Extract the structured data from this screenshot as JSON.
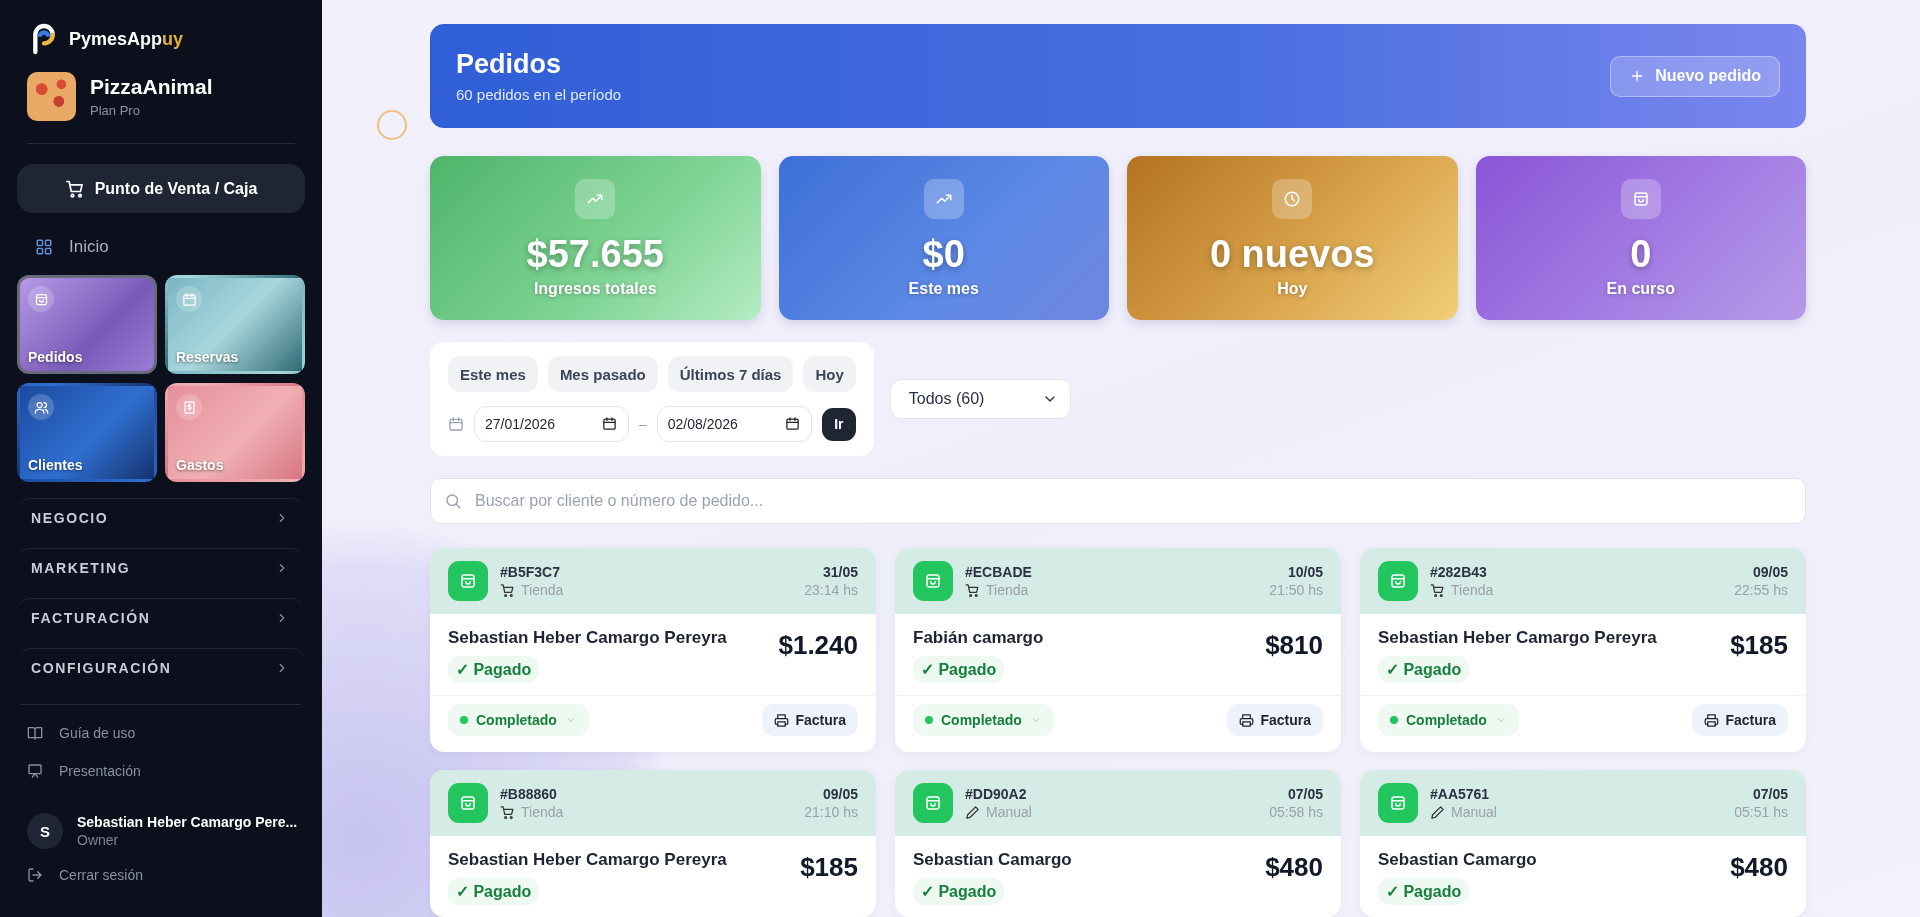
{
  "sidebar": {
    "brand": {
      "prefix": "PymesApp",
      "suffix": "uy"
    },
    "business": {
      "name": "PizzaAnimal",
      "plan": "Plan Pro"
    },
    "pos_button": "Punto de Venta / Caja",
    "home": "Inicio",
    "tiles": [
      {
        "label": "Pedidos",
        "kind": "pedidos",
        "selected": true
      },
      {
        "label": "Reservas",
        "kind": "reservas",
        "selected": false
      },
      {
        "label": "Clientes",
        "kind": "clientes",
        "selected": false
      },
      {
        "label": "Gastos",
        "kind": "gastos",
        "selected": false
      }
    ],
    "sections": [
      {
        "label": "NEGOCIO",
        "expanded": false
      },
      {
        "label": "MARKETING",
        "expanded": false
      },
      {
        "label": "FACTURACIÓN",
        "expanded": false
      },
      {
        "label": "CONFIGURACIÓN",
        "expanded": false
      }
    ],
    "links": [
      {
        "label": "Guía de uso",
        "kind": "guide"
      },
      {
        "label": "Presentación",
        "kind": "presentation"
      }
    ],
    "user": {
      "initial": "S",
      "name": "Sebastian Heber Camargo Pere...",
      "role": "Owner"
    },
    "logout": "Cerrar sesión"
  },
  "header": {
    "title": "Pedidos",
    "subtitle": "60 pedidos en el período",
    "button": "Nuevo pedido"
  },
  "stats": [
    {
      "value": "$57.655",
      "label": "Ingresos totales",
      "kind": "revenue"
    },
    {
      "value": "$0",
      "label": "Este mes",
      "kind": "month"
    },
    {
      "value": "0 nuevos",
      "label": "Hoy",
      "kind": "today"
    },
    {
      "value": "0",
      "label": "En curso",
      "kind": "progress"
    }
  ],
  "filters": {
    "presets": [
      {
        "label": "Este mes",
        "selected": false
      },
      {
        "label": "Mes pasado",
        "selected": false
      },
      {
        "label": "Últimos 7 días",
        "selected": false
      },
      {
        "label": "Hoy",
        "selected": false
      }
    ],
    "date_from": "27/01/2026",
    "separator": "–",
    "date_to": "02/08/2026",
    "go_button": "Ir",
    "status_select": "Todos (60)"
  },
  "search": {
    "placeholder": "Buscar por cliente o número de pedido..."
  },
  "orders": [
    {
      "id": "#B5F3C7",
      "source": "Tienda",
      "kind": "store",
      "date": "31/05",
      "time": "23:14 hs",
      "customer": "Sebastian Heber Camargo Pereyra",
      "total": "$1.240",
      "payment": "✓ Pagado",
      "status": "Completado",
      "invoice": "Factura"
    },
    {
      "id": "#ECBADE",
      "source": "Tienda",
      "kind": "store",
      "date": "10/05",
      "time": "21:50 hs",
      "customer": "Fabián camargo",
      "total": "$810",
      "payment": "✓ Pagado",
      "status": "Completado",
      "invoice": "Factura"
    },
    {
      "id": "#282B43",
      "source": "Tienda",
      "kind": "store",
      "date": "09/05",
      "time": "22:55 hs",
      "customer": "Sebastian Heber Camargo Pereyra",
      "total": "$185",
      "payment": "✓ Pagado",
      "status": "Completado",
      "invoice": "Factura"
    },
    {
      "id": "#B88860",
      "source": "Tienda",
      "kind": "store",
      "date": "09/05",
      "time": "21:10 hs",
      "customer": "Sebastian Heber Camargo Pereyra",
      "total": "$185",
      "payment": "✓ Pagado"
    },
    {
      "id": "#DD90A2",
      "source": "Manual",
      "kind": "manual",
      "date": "07/05",
      "time": "05:58 hs",
      "customer": "Sebastian Camargo",
      "total": "$480",
      "payment": "✓ Pagado"
    },
    {
      "id": "#AA5761",
      "source": "Manual",
      "kind": "manual",
      "date": "07/05",
      "time": "05:51 hs",
      "customer": "Sebastian Camargo",
      "total": "$480",
      "payment": "✓ Pagado"
    }
  ]
}
